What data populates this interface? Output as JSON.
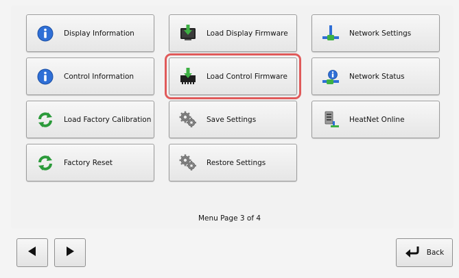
{
  "menu": {
    "tiles": [
      {
        "label": "Display Information",
        "icon": "info-icon"
      },
      {
        "label": "Control Information",
        "icon": "info-icon"
      },
      {
        "label": "Load Factory Calibration",
        "icon": "refresh-icon"
      },
      {
        "label": "Factory Reset",
        "icon": "refresh-icon"
      },
      {
        "label": "Load Display Firmware",
        "icon": "download-monitor-icon"
      },
      {
        "label": "Load Control Firmware",
        "icon": "download-chip-icon"
      },
      {
        "label": "Save Settings",
        "icon": "gears-icon"
      },
      {
        "label": "Restore Settings",
        "icon": "gears-icon"
      },
      {
        "label": "Network Settings",
        "icon": "network-icon"
      },
      {
        "label": "Network Status",
        "icon": "network-status-icon"
      },
      {
        "label": "HeatNet Online",
        "icon": "heatnet-server-icon"
      }
    ],
    "selected_label": "Load Control Firmware",
    "page_text": "Menu Page 3 of 4"
  },
  "nav": {
    "back_label": "Back"
  },
  "colors": {
    "info_blue": "#2f6fd6",
    "refresh_green": "#2b9a3a",
    "download_green": "#3db043",
    "selection_outline": "#e05a5a"
  }
}
